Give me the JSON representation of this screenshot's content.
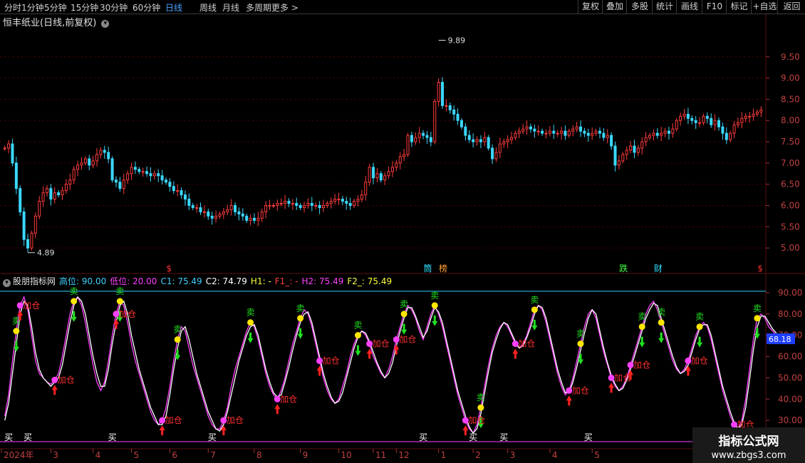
{
  "toolbar": {
    "periods": [
      "分时",
      "1分钟",
      "5分钟",
      "15分钟",
      "30分钟",
      "60分钟",
      "日线",
      "周线",
      "月线",
      "多周期",
      "更多 >"
    ],
    "active_period": "日线",
    "right_buttons": [
      "复权",
      "叠加",
      "多股",
      "统计",
      "画线",
      "F10",
      "标记",
      "+自选",
      "返回"
    ]
  },
  "main_header": {
    "title": "恒丰纸业(日线,前复权)"
  },
  "indicator_header": {
    "name": "股朋指标网",
    "items": [
      {
        "text": "高位: 90.00",
        "color": "#3fd0ff"
      },
      {
        "text": "低位: 20.00",
        "color": "#ff40ff"
      },
      {
        "text": "C1: 75.49",
        "color": "#3fd0ff"
      },
      {
        "text": "C2: 74.79",
        "color": "#ffffff"
      },
      {
        "text": "H1: -",
        "color": "#ffff40"
      },
      {
        "text": "F1_: -",
        "color": "#ff4040"
      },
      {
        "text": "H2: 75.49",
        "color": "#ff40ff"
      },
      {
        "text": "F2_: 75.49",
        "color": "#ffff40"
      }
    ]
  },
  "chart_data": [
    {
      "type": "candlestick",
      "title": "恒丰纸业(日线,前复权)",
      "ylim": [
        4.6,
        10.2
      ],
      "yticks": [
        "9.50",
        "9.00",
        "8.50",
        "8.00",
        "7.50",
        "7.00",
        "6.50",
        "6.00",
        "5.50",
        "5.00"
      ],
      "ytick_values": [
        9.5,
        9.0,
        8.5,
        8.0,
        7.5,
        7.0,
        6.5,
        6.0,
        5.5,
        5.0
      ],
      "annotations": [
        {
          "text": "9.89",
          "value": 9.89,
          "index": 113
        },
        {
          "text": "4.89",
          "value": 4.89,
          "index": 6
        }
      ],
      "markers": [
        {
          "text": "$",
          "index": 43,
          "color": "#ff3030"
        },
        {
          "text": "筒",
          "index": 110,
          "color": "#30e0ff"
        },
        {
          "text": "榜",
          "index": 114,
          "color": "#ffa030"
        },
        {
          "text": "跌",
          "index": 161,
          "color": "#40ff40"
        },
        {
          "text": "财",
          "index": 170,
          "color": "#30e0ff"
        },
        {
          "text": "$",
          "index": 197,
          "color": "#ff3030"
        }
      ],
      "close": [
        7.35,
        7.45,
        7.0,
        6.4,
        5.85,
        5.2,
        5.0,
        5.35,
        5.75,
        6.1,
        6.3,
        6.4,
        6.15,
        6.3,
        6.25,
        6.35,
        6.5,
        6.6,
        6.85,
        6.95,
        7.0,
        7.1,
        6.95,
        7.05,
        7.2,
        7.3,
        7.25,
        7.1,
        6.6,
        6.55,
        6.4,
        6.6,
        6.75,
        6.9,
        6.85,
        6.8,
        6.8,
        6.75,
        6.7,
        6.75,
        6.7,
        6.6,
        6.55,
        6.45,
        6.35,
        6.35,
        6.25,
        6.15,
        6.0,
        5.95,
        5.95,
        5.85,
        5.85,
        5.75,
        5.7,
        5.75,
        5.8,
        5.85,
        5.9,
        6.0,
        5.85,
        5.8,
        5.75,
        5.65,
        5.7,
        5.65,
        5.7,
        5.85,
        6.0,
        6.0,
        6.0,
        6.05,
        6.05,
        6.1,
        6.05,
        6.05,
        6.0,
        5.95,
        6.0,
        6.05,
        6.0,
        6.0,
        5.95,
        6.0,
        6.05,
        6.1,
        6.15,
        6.15,
        6.1,
        6.05,
        6.0,
        6.1,
        6.15,
        6.25,
        6.55,
        6.9,
        6.65,
        6.75,
        6.6,
        6.7,
        6.8,
        6.9,
        7.0,
        7.15,
        7.2,
        7.65,
        7.5,
        7.6,
        7.7,
        7.65,
        7.6,
        7.5,
        8.45,
        8.9,
        8.35,
        8.35,
        8.25,
        8.15,
        8.0,
        7.85,
        7.65,
        7.55,
        7.5,
        7.55,
        7.5,
        7.6,
        7.35,
        7.1,
        7.25,
        7.45,
        7.5,
        7.55,
        7.6,
        7.7,
        7.75,
        7.8,
        7.85,
        7.8,
        7.75,
        7.75,
        7.7,
        7.7,
        7.75,
        7.7,
        7.7,
        7.75,
        7.65,
        7.75,
        7.8,
        7.85,
        7.75,
        7.7,
        7.65,
        7.7,
        7.75,
        7.7,
        7.6,
        7.65,
        7.4,
        6.95,
        7.05,
        7.2,
        7.3,
        7.4,
        7.25,
        7.35,
        7.5,
        7.6,
        7.65,
        7.7,
        7.65,
        7.7,
        7.75,
        7.7,
        7.8,
        8.0,
        8.1,
        8.15,
        8.05,
        8.0,
        7.95,
        7.95,
        8.1,
        8.05,
        7.9,
        8.0,
        7.85,
        7.7,
        7.55,
        7.7,
        7.9,
        7.95,
        8.05,
        8.1,
        8.1,
        8.15,
        8.2,
        8.25
      ]
    },
    {
      "type": "line",
      "title": "股朋指标网",
      "ylim": [
        20,
        95
      ],
      "yticks": [
        "90.00",
        "80.00",
        "70.00",
        "60.00",
        "50.00",
        "40.00",
        "30.00"
      ],
      "ytick_values": [
        90,
        80,
        70,
        60,
        50,
        40,
        30
      ],
      "last_value": "68.18",
      "reference_lines": [
        {
          "name": "高位",
          "value": 90
        },
        {
          "name": "低位",
          "value": 20
        }
      ],
      "series": [
        {
          "name": "C1",
          "values": [
            32,
            42,
            58,
            72,
            84,
            88,
            82,
            70,
            58,
            52,
            50,
            48,
            47,
            49,
            52,
            60,
            70,
            80,
            86,
            88,
            84,
            76,
            66,
            56,
            48,
            44,
            48,
            58,
            70,
            80,
            86,
            84,
            76,
            66,
            58,
            52,
            46,
            40,
            34,
            30,
            28,
            30,
            36,
            46,
            58,
            68,
            74,
            72,
            64,
            56,
            50,
            44,
            38,
            32,
            28,
            26,
            26,
            30,
            36,
            46,
            54,
            60,
            66,
            72,
            76,
            74,
            68,
            60,
            52,
            46,
            42,
            40,
            44,
            50,
            58,
            66,
            72,
            78,
            82,
            80,
            74,
            66,
            58,
            50,
            44,
            40,
            38,
            40,
            46,
            52,
            60,
            66,
            70,
            72,
            70,
            66,
            60,
            56,
            52,
            50,
            54,
            60,
            68,
            74,
            80,
            84,
            82,
            78,
            72,
            68,
            74,
            80,
            84,
            80,
            74,
            66,
            58,
            50,
            42,
            36,
            30,
            26,
            24,
            28,
            36,
            46,
            56,
            64,
            70,
            74,
            76,
            74,
            70,
            66,
            64,
            66,
            70,
            76,
            82,
            84,
            82,
            76,
            68,
            60,
            52,
            46,
            42,
            44,
            50,
            58,
            66,
            74,
            80,
            82,
            78,
            70,
            62,
            56,
            50,
            46,
            44,
            46,
            50,
            56,
            62,
            68,
            74,
            80,
            84,
            86,
            82,
            76,
            70,
            64,
            58,
            54,
            52,
            54,
            58,
            64,
            70,
            74,
            76,
            74,
            68,
            60,
            52,
            44,
            38,
            32,
            28,
            26,
            30,
            40,
            54,
            68,
            78,
            80,
            78,
            74,
            72,
            70
          ]
        },
        {
          "name": "C2",
          "values": [
            30,
            38,
            52,
            66,
            80,
            86,
            84,
            74,
            62,
            54,
            50,
            48,
            46,
            48,
            50,
            56,
            66,
            76,
            84,
            88,
            86,
            80,
            70,
            60,
            52,
            46,
            46,
            54,
            66,
            76,
            84,
            86,
            80,
            70,
            62,
            54,
            48,
            42,
            36,
            32,
            28,
            28,
            32,
            42,
            54,
            64,
            72,
            74,
            68,
            60,
            52,
            46,
            40,
            34,
            30,
            26,
            25,
            28,
            34,
            42,
            50,
            58,
            64,
            70,
            74,
            75,
            70,
            62,
            54,
            48,
            43,
            41,
            42,
            48,
            55,
            63,
            70,
            76,
            80,
            81,
            76,
            68,
            60,
            52,
            46,
            41,
            38,
            39,
            43,
            50,
            57,
            64,
            69,
            72,
            71,
            67,
            62,
            57,
            53,
            50,
            52,
            57,
            65,
            72,
            78,
            83,
            83,
            79,
            74,
            69,
            72,
            78,
            83,
            81,
            76,
            68,
            60,
            52,
            44,
            38,
            32,
            27,
            24,
            26,
            33,
            43,
            53,
            62,
            68,
            73,
            76,
            75,
            71,
            67,
            64,
            65,
            69,
            74,
            80,
            84,
            83,
            78,
            70,
            62,
            54,
            48,
            43,
            43,
            48,
            55,
            63,
            71,
            78,
            82,
            80,
            72,
            64,
            57,
            51,
            47,
            44,
            45,
            49,
            54,
            60,
            66,
            72,
            78,
            82,
            85,
            84,
            78,
            72,
            66,
            60,
            55,
            52,
            53,
            56,
            62,
            68,
            73,
            75,
            75,
            70,
            62,
            54,
            46,
            40,
            34,
            29,
            26,
            28,
            36,
            49,
            63,
            74,
            79,
            79,
            76,
            73,
            71
          ]
        }
      ]
    }
  ],
  "buy_sell_legend": {
    "buy": "买",
    "sell": "卖",
    "add": "加仓"
  },
  "signals": {
    "sell": [
      3,
      18,
      30,
      45,
      64,
      77,
      92,
      104,
      112,
      124,
      138,
      150,
      166,
      171,
      181,
      196
    ],
    "add": [
      4,
      13,
      29,
      41,
      57,
      71,
      82,
      95,
      102,
      120,
      133,
      147,
      158,
      163,
      178,
      190
    ],
    "buy": [
      1,
      6,
      28,
      54,
      109,
      122,
      130,
      152
    ]
  },
  "time_axis": {
    "labels": [
      {
        "text": "2024年",
        "index": 0
      },
      {
        "text": "3",
        "index": 12
      },
      {
        "text": "4",
        "index": 23
      },
      {
        "text": "5",
        "index": 33
      },
      {
        "text": "6",
        "index": 43
      },
      {
        "text": "7",
        "index": 53
      },
      {
        "text": "8",
        "index": 65
      },
      {
        "text": "9",
        "index": 77
      },
      {
        "text": "10",
        "index": 87
      },
      {
        "text": "11",
        "index": 96
      },
      {
        "text": "12",
        "index": 102
      },
      {
        "text": "1",
        "index": 113
      },
      {
        "text": "2",
        "index": 122
      },
      {
        "text": "3",
        "index": 131
      },
      {
        "text": "4",
        "index": 142
      },
      {
        "text": "5",
        "index": 153
      }
    ]
  },
  "watermark": {
    "line1": "指标公式网",
    "line2": "www.zbgs3.com"
  }
}
